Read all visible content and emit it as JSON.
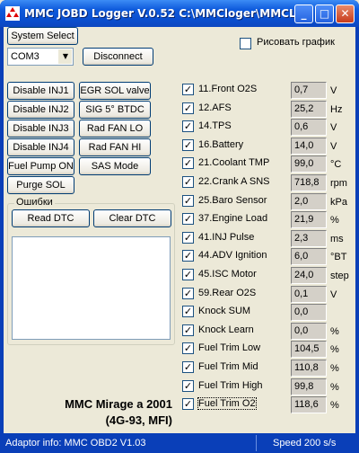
{
  "window": {
    "title": "MMC JOBD Logger V.0.52  C:\\MMCloger\\MMCL...",
    "minimize": "_",
    "maximize": "□",
    "close": "✕"
  },
  "toolbar": {
    "system_select": "System Select",
    "com_port": "COM3",
    "disconnect": "Disconnect",
    "draw_chart": "Рисовать график",
    "draw_chart_checked": false
  },
  "actions": {
    "left": [
      "Disable INJ1",
      "Disable INJ2",
      "Disable INJ3",
      "Disable INJ4",
      "Fuel Pump ON",
      "Purge SOL"
    ],
    "right": [
      "EGR SOL valve",
      "SIG 5° BTDC",
      "Rad FAN LO",
      "Rad FAN HI",
      "SAS Mode"
    ]
  },
  "errors": {
    "title": "Ошибки",
    "read_dtc": "Read DTC",
    "clear_dtc": "Clear DTC"
  },
  "params": [
    {
      "name": "11.Front O2S",
      "value": "0,7",
      "unit": "V",
      "checked": true
    },
    {
      "name": "12.AFS",
      "value": "25,2",
      "unit": "Hz",
      "checked": true
    },
    {
      "name": "14.TPS",
      "value": "0,6",
      "unit": "V",
      "checked": true
    },
    {
      "name": "16.Battery",
      "value": "14,0",
      "unit": "V",
      "checked": true
    },
    {
      "name": "21.Coolant TMP",
      "value": "99,0",
      "unit": "°C",
      "checked": true
    },
    {
      "name": "22.Crank A SNS",
      "value": "718,8",
      "unit": "rpm",
      "checked": true
    },
    {
      "name": "25.Baro Sensor",
      "value": "2,0",
      "unit": "kPa",
      "checked": true
    },
    {
      "name": "37.Engine Load",
      "value": "21,9",
      "unit": "%",
      "checked": true
    },
    {
      "name": "41.INJ Pulse",
      "value": "2,3",
      "unit": "ms",
      "checked": true
    },
    {
      "name": "44.ADV Ignition",
      "value": "6,0",
      "unit": "°BT",
      "checked": true
    },
    {
      "name": "45.ISC Motor",
      "value": "24,0",
      "unit": "step",
      "checked": true
    },
    {
      "name": "59.Rear O2S",
      "value": "0,1",
      "unit": "V",
      "checked": true
    },
    {
      "name": "Knock SUM",
      "value": "0,0",
      "unit": "",
      "checked": true
    },
    {
      "name": "Knock Learn",
      "value": "0,0",
      "unit": "%",
      "checked": true
    },
    {
      "name": "Fuel Trim Low",
      "value": "104,5",
      "unit": "%",
      "checked": true
    },
    {
      "name": "Fuel Trim Mid",
      "value": "110,8",
      "unit": "%",
      "checked": true
    },
    {
      "name": "Fuel Trim High",
      "value": "99,8",
      "unit": "%",
      "checked": true
    },
    {
      "name": "Fuel Trim O2",
      "value": "118,6",
      "unit": "%",
      "checked": true
    }
  ],
  "car": {
    "line1": "MMC Mirage a 2001",
    "line2": "(4G-93, MFI)"
  },
  "status": {
    "adaptor": "Adaptor info: MMC OBD2 V1.03",
    "speed": "Speed 200 s/s"
  },
  "colors": {
    "titlebar": "#0f5bdc",
    "face": "#ece9d8",
    "value_box": "#d4d0c8"
  }
}
